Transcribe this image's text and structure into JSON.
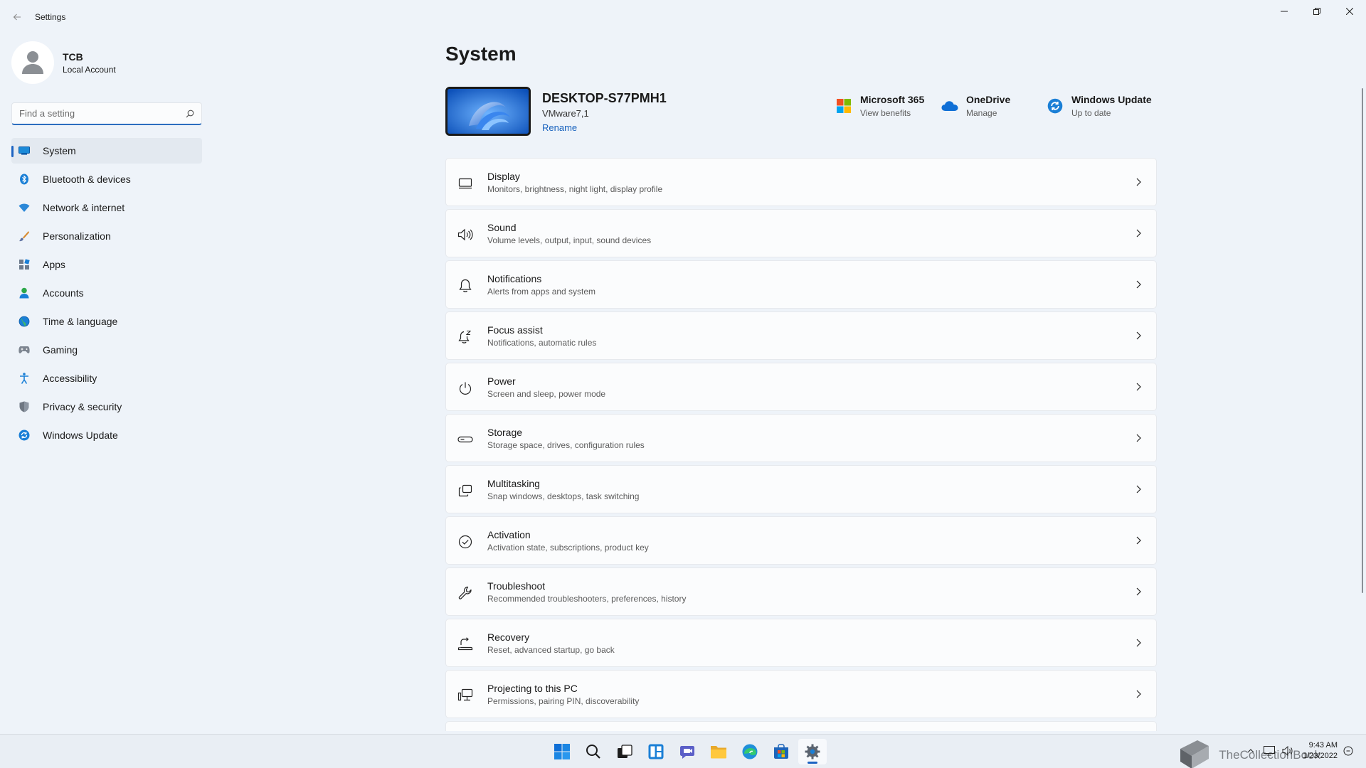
{
  "window": {
    "title": "Settings"
  },
  "profile": {
    "name": "TCB",
    "account_type": "Local Account"
  },
  "search": {
    "placeholder": "Find a setting"
  },
  "sidebar": {
    "items": [
      {
        "label": "System",
        "icon": "system-icon",
        "active": true
      },
      {
        "label": "Bluetooth & devices",
        "icon": "bluetooth-icon"
      },
      {
        "label": "Network & internet",
        "icon": "network-icon"
      },
      {
        "label": "Personalization",
        "icon": "brush-icon"
      },
      {
        "label": "Apps",
        "icon": "apps-icon"
      },
      {
        "label": "Accounts",
        "icon": "accounts-icon"
      },
      {
        "label": "Time & language",
        "icon": "time-language-icon"
      },
      {
        "label": "Gaming",
        "icon": "gaming-icon"
      },
      {
        "label": "Accessibility",
        "icon": "accessibility-icon"
      },
      {
        "label": "Privacy & security",
        "icon": "shield-icon"
      },
      {
        "label": "Windows Update",
        "icon": "windows-update-icon"
      }
    ]
  },
  "main": {
    "title": "System",
    "device": {
      "name": "DESKTOP-S77PMH1",
      "model": "VMware7,1",
      "rename": "Rename"
    },
    "quick_links": [
      {
        "title": "Microsoft 365",
        "subtitle": "View benefits",
        "icon": "microsoft-365-icon"
      },
      {
        "title": "OneDrive",
        "subtitle": "Manage",
        "icon": "onedrive-icon"
      },
      {
        "title": "Windows Update",
        "subtitle": "Up to date",
        "icon": "windows-update-icon"
      }
    ],
    "cards": [
      {
        "title": "Display",
        "subtitle": "Monitors, brightness, night light, display profile",
        "icon": "display-icon"
      },
      {
        "title": "Sound",
        "subtitle": "Volume levels, output, input, sound devices",
        "icon": "speaker-icon"
      },
      {
        "title": "Notifications",
        "subtitle": "Alerts from apps and system",
        "icon": "bell-icon"
      },
      {
        "title": "Focus assist",
        "subtitle": "Notifications, automatic rules",
        "icon": "focus-assist-icon"
      },
      {
        "title": "Power",
        "subtitle": "Screen and sleep, power mode",
        "icon": "power-icon"
      },
      {
        "title": "Storage",
        "subtitle": "Storage space, drives, configuration rules",
        "icon": "storage-icon"
      },
      {
        "title": "Multitasking",
        "subtitle": "Snap windows, desktops, task switching",
        "icon": "multitasking-icon"
      },
      {
        "title": "Activation",
        "subtitle": "Activation state, subscriptions, product key",
        "icon": "check-circle-icon"
      },
      {
        "title": "Troubleshoot",
        "subtitle": "Recommended troubleshooters, preferences, history",
        "icon": "wrench-icon"
      },
      {
        "title": "Recovery",
        "subtitle": "Reset, advanced startup, go back",
        "icon": "recovery-icon"
      },
      {
        "title": "Projecting to this PC",
        "subtitle": "Permissions, pairing PIN, discoverability",
        "icon": "projecting-icon"
      }
    ]
  },
  "taskbar": {
    "apps": [
      "start-icon",
      "search-icon",
      "task-view-icon",
      "widgets-icon",
      "chat-icon",
      "file-explorer-icon",
      "edge-icon",
      "store-icon",
      "settings-icon"
    ],
    "clock": {
      "time": "9:43 AM",
      "date": "1/23/2022"
    },
    "watermark": "TheCollectionBook"
  },
  "colors": {
    "accent": "#1c63c2",
    "background": "#eef3f9",
    "card": "#fbfcfd"
  }
}
